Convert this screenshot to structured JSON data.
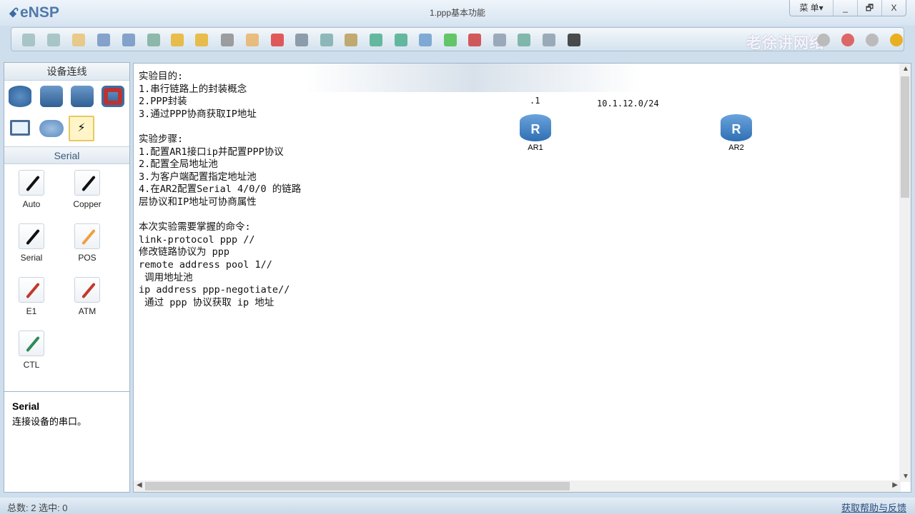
{
  "app": {
    "name": "eNSP",
    "window_title": "1.ppp基本功能",
    "menu_label": "菜 单▾",
    "minimize": "_",
    "restore": "🗗",
    "close": "X",
    "watermark": "老徐讲网络"
  },
  "toolbar": {
    "icons": [
      "new-topology",
      "new-example",
      "open",
      "save",
      "save-as",
      "print",
      "undo",
      "redo",
      "select",
      "pan",
      "delete",
      "delete-link",
      "text",
      "palette",
      "zoom-in",
      "zoom-out",
      "fit",
      "start",
      "stop",
      "capture",
      "topology",
      "grid",
      "terminal"
    ],
    "right_icons": [
      "chat",
      "settings",
      "huawei",
      "help"
    ]
  },
  "left_panel": {
    "title": "设备连线",
    "devices": [
      "router",
      "switch",
      "wireless",
      "firewall",
      "pc",
      "cloud",
      "connection"
    ],
    "section": "Serial",
    "links": [
      {
        "label": "Auto",
        "color": "#111"
      },
      {
        "label": "Copper",
        "color": "#111"
      },
      {
        "label": "Serial",
        "color": "#111"
      },
      {
        "label": "POS",
        "color": "#f0a040"
      },
      {
        "label": "E1",
        "color": "#c0392b"
      },
      {
        "label": "ATM",
        "color": "#c0392b"
      },
      {
        "label": "CTL",
        "color": "#2e8b57"
      }
    ],
    "desc_title": "Serial",
    "desc_text": "连接设备的串口。"
  },
  "canvas": {
    "notes": "实验目的:\n1.串行链路上的封装概念\n2.PPP封装\n3.通过PPP协商获取IP地址\n\n实验步骤:\n1.配置AR1接口ip并配置PPP协议\n2.配置全局地址池\n3.为客户端配置指定地址池\n4.在AR2配置Serial 4/0/0 的链路\n层协议和IP地址可协商属性\n\n本次实验需要掌握的命令:\nlink-protocol ppp //\n修改链路协议为 ppp\nremote address pool 1//\n 调用地址池\nip address ppp-negotiate//\n 通过 ppp 协议获取 ip 地址",
    "label_dot1": ".1",
    "subnet": "10.1.12.0/24",
    "routers": [
      {
        "name": "AR1",
        "glyph": "R"
      },
      {
        "name": "AR2",
        "glyph": "R"
      }
    ]
  },
  "status": {
    "left": "总数: 2 选中: 0",
    "help_link": "获取帮助与反馈"
  }
}
